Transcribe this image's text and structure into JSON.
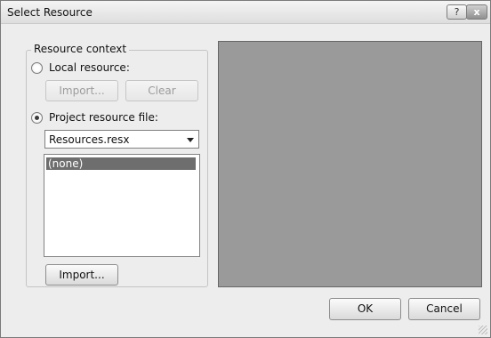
{
  "window": {
    "title": "Select Resource",
    "help_label": "?",
    "close_label": "x"
  },
  "resource_context": {
    "group_label": "Resource context",
    "local_resource_label": "Local resource:",
    "local_selected": false,
    "import_label": "Import...",
    "clear_label": "Clear",
    "project_resource_label": "Project resource file:",
    "project_selected": true,
    "resource_file_value": "Resources.resx",
    "resources": [
      "(none)"
    ],
    "import_bottom_label": "Import..."
  },
  "footer": {
    "ok_label": "OK",
    "cancel_label": "Cancel"
  },
  "colors": {
    "preview_background": "#9a9a9a",
    "selected_item": "#6e6e6e"
  }
}
